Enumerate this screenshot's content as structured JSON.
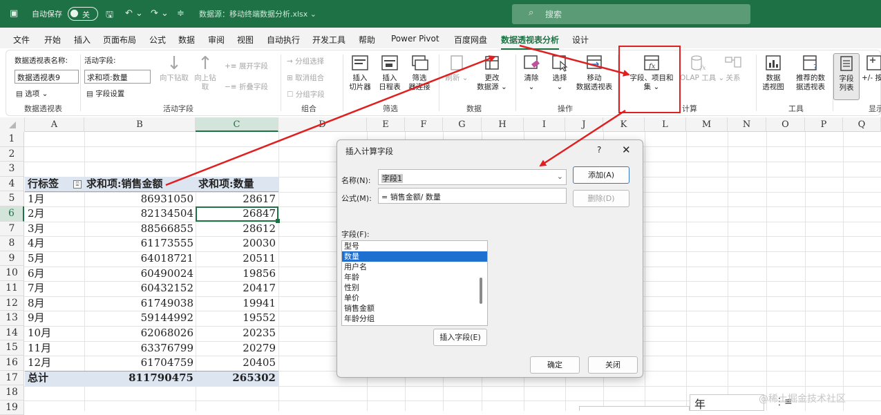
{
  "titlebar": {
    "autosave_label": "自动保存",
    "autosave_state": "关",
    "doc_title": "数据源：移动终端数据分析.xlsx ⌄",
    "search_placeholder": "搜索"
  },
  "tabs": [
    "文件",
    "开始",
    "插入",
    "页面布局",
    "公式",
    "数据",
    "审阅",
    "视图",
    "自动执行",
    "开发工具",
    "帮助",
    "Power Pivot",
    "百度网盘",
    "数据透视表分析",
    "设计"
  ],
  "active_tab": "数据透视表分析",
  "ribbon": {
    "pt_name_label": "数据透视表名称:",
    "pt_name_value": "数据透视表9",
    "options_label": "选项",
    "group_pivottable": "数据透视表",
    "active_field_label": "活动字段:",
    "active_field_value": "求和项:数量",
    "field_settings_label": "字段设置",
    "drill_down": "向下钻取",
    "drill_up_1": "向上钻",
    "drill_up_2": "取",
    "expand_field": "展开字段",
    "collapse_field": "折叠字段",
    "group_active_field": "活动字段",
    "group_selection": "分组选择",
    "ungroup": "取消组合",
    "group_field": "分组字段",
    "group_group": "组合",
    "insert_slicer_1": "插入",
    "insert_slicer_2": "切片器",
    "insert_timeline_1": "插入",
    "insert_timeline_2": "日程表",
    "filter_conn_1": "筛选",
    "filter_conn_2": "器连接",
    "group_filter": "筛选",
    "refresh": "刷新",
    "change_source_1": "更改",
    "change_source_2": "数据源",
    "group_data": "数据",
    "clear": "清除",
    "select": "选择",
    "move_pt_1": "移动",
    "move_pt_2": "数据透视表",
    "group_actions": "操作",
    "fields_items_1": "字段、项目和",
    "fields_items_2": "集",
    "olap_tools": "OLAP 工具",
    "relationships": "关系",
    "group_calculations": "计算",
    "pivotchart_1": "数据",
    "pivotchart_2": "透视图",
    "recommended_1": "推荐的数",
    "recommended_2": "据透视表",
    "group_tools": "工具",
    "field_list_1": "字段",
    "field_list_2": "列表",
    "plusminus": "+/- 按",
    "group_show": "显示"
  },
  "sheet": {
    "columns": [
      "A",
      "B",
      "C",
      "D",
      "E",
      "F",
      "G",
      "H",
      "I",
      "J",
      "K",
      "L",
      "M",
      "N",
      "O",
      "P",
      "Q"
    ],
    "rows": [
      "1",
      "2",
      "3",
      "4",
      "5",
      "6",
      "7",
      "8",
      "9",
      "10",
      "11",
      "12",
      "13",
      "14",
      "15",
      "16",
      "17",
      "18",
      "19"
    ],
    "header": [
      "行标签",
      "求和项:销售金额",
      "求和项:数量"
    ],
    "data": [
      [
        "1月",
        "86931050",
        "28617"
      ],
      [
        "2月",
        "82134504",
        "26847"
      ],
      [
        "3月",
        "88566855",
        "28612"
      ],
      [
        "4月",
        "61173555",
        "20030"
      ],
      [
        "5月",
        "64018721",
        "20511"
      ],
      [
        "6月",
        "60490024",
        "19856"
      ],
      [
        "7月",
        "60432152",
        "20417"
      ],
      [
        "8月",
        "61749038",
        "19941"
      ],
      [
        "9月",
        "59144992",
        "19552"
      ],
      [
        "10月",
        "62068026",
        "20235"
      ],
      [
        "11月",
        "63376799",
        "20279"
      ],
      [
        "12月",
        "61704759",
        "20405"
      ]
    ],
    "total": [
      "总计",
      "811790475",
      "265302"
    ]
  },
  "dialog": {
    "title": "插入计算字段",
    "help": "?",
    "close": "✕",
    "name_label": "名称(N):",
    "name_value": "字段1",
    "add_button": "添加(A)",
    "formula_label": "公式(M):",
    "formula_value": "= 销售金额/ 数量",
    "delete_button": "删除(D)",
    "fields_label": "字段(F):",
    "fields": [
      "型号",
      "数量",
      "用户名",
      "年龄",
      "性别",
      "单价",
      "销售金额",
      "年龄分组"
    ],
    "selected_field": "数量",
    "insert_field_button": "插入字段(E)",
    "ok_button": "确定",
    "close_button": "关闭"
  },
  "fragments": {
    "frag_char": "年"
  },
  "watermark": "@稀土掘金技术社区",
  "colors": {
    "excel_green": "#1e7145",
    "annotation_red": "#e02020",
    "selection_blue": "#1e6fd0"
  }
}
